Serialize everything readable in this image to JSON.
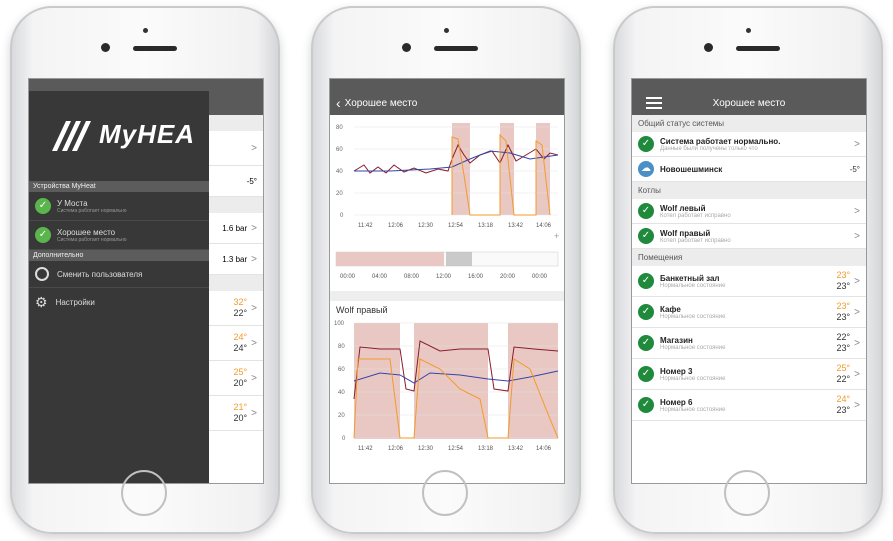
{
  "phone1": {
    "brand": "MyHEAT",
    "devices_header": "Устройства MyHeat",
    "devices": [
      {
        "name": "У Моста",
        "status": "Система работает нормально"
      },
      {
        "name": "Хорошее место",
        "status": "Система работает нормально"
      }
    ],
    "extra_header": "Дополнительно",
    "change_user": "Сменить пользователя",
    "settings": "Настройки",
    "bg_values": [
      "-5°",
      "1.6 bar",
      "1.3 bar"
    ],
    "bg_temps": [
      [
        "32°",
        "22°"
      ],
      [
        "24°",
        "24°"
      ],
      [
        "25°",
        "20°"
      ],
      [
        "21°",
        "20°"
      ]
    ]
  },
  "phone2": {
    "title": "Хорошее место",
    "chart1_times": [
      "11:42",
      "12:06",
      "12:30",
      "12:54",
      "13:18",
      "13:42",
      "14:06"
    ],
    "chart1_y": [
      "80",
      "60",
      "40",
      "20",
      "0"
    ],
    "mini_times": [
      "00:00",
      "04:00",
      "08:00",
      "12:00",
      "16:00",
      "20:00",
      "00:00"
    ],
    "chart2_title": "Wolf правый",
    "chart2_y": [
      "100",
      "80",
      "60",
      "40",
      "20",
      "0"
    ],
    "chart2_times": [
      "11:42",
      "12:06",
      "12:30",
      "12:54",
      "13:18",
      "13:42",
      "14:06"
    ]
  },
  "phone3": {
    "title": "Хорошее место",
    "status_header": "Общий статус системы",
    "status_title": "Система работает нормально.",
    "status_sub": "Данные были получены только что",
    "weather_name": "Новошешминск",
    "weather_temp": "-5°",
    "boilers_header": "Котлы",
    "boilers": [
      {
        "name": "Wolf левый",
        "sub": "Котел работает исправно"
      },
      {
        "name": "Wolf правый",
        "sub": "Котел работает исправно"
      }
    ],
    "rooms_header": "Помещения",
    "rooms": [
      {
        "name": "Банкетный зал",
        "sub": "Нормальное состояние",
        "set": "23°",
        "cur": "23°"
      },
      {
        "name": "Кафе",
        "sub": "Нормальное состояние",
        "set": "23°",
        "cur": "23°"
      },
      {
        "name": "Магазин",
        "sub": "Нормальное состояние",
        "set": "22°",
        "cur": "23°"
      },
      {
        "name": "Номер 3",
        "sub": "Нормальное состояние",
        "set": "25°",
        "cur": "22°"
      },
      {
        "name": "Номер 6",
        "sub": "Нормальное состояние",
        "set": "24°",
        "cur": "23°"
      }
    ]
  },
  "colors": {
    "green": "#1f8a3b",
    "navbar": "#5a5a5a",
    "orange": "#f39a2b",
    "burgundy": "#8a1c2a",
    "blue": "#3346a8"
  }
}
